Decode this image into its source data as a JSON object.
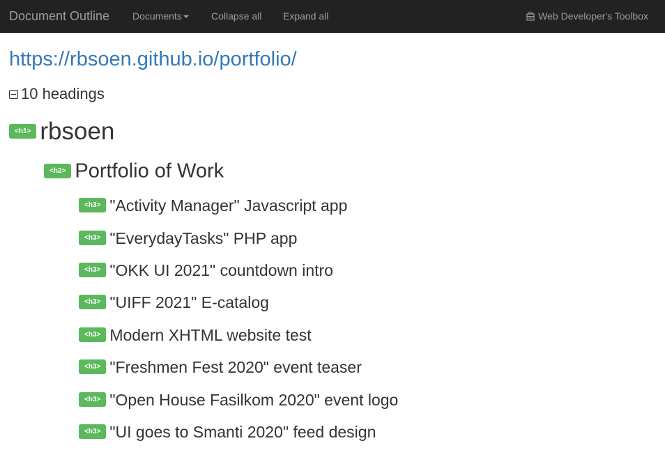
{
  "navbar": {
    "brand": "Document Outline",
    "documents_label": "Documents",
    "collapse_label": "Collapse all",
    "expand_label": "Expand all",
    "toolbox_label": "Web Developer's Toolbox"
  },
  "page": {
    "url": "https://rbsoen.github.io/portfolio/",
    "heading_count": "10 headings"
  },
  "headings": [
    {
      "tag": "<h1>",
      "text": "rbsoen"
    },
    {
      "tag": "<h2>",
      "text": "Portfolio of Work"
    },
    {
      "tag": "<h3>",
      "text": "\"Activity Manager\" Javascript app"
    },
    {
      "tag": "<h3>",
      "text": "\"EverydayTasks\" PHP app"
    },
    {
      "tag": "<h3>",
      "text": "\"OKK UI 2021\" countdown intro"
    },
    {
      "tag": "<h3>",
      "text": "\"UIFF 2021\" E-catalog"
    },
    {
      "tag": "<h3>",
      "text": "Modern XHTML website test"
    },
    {
      "tag": "<h3>",
      "text": "\"Freshmen Fest 2020\" event teaser"
    },
    {
      "tag": "<h3>",
      "text": "\"Open House Fasilkom 2020\" event logo"
    },
    {
      "tag": "<h3>",
      "text": "\"UI goes to Smanti 2020\" feed design"
    }
  ],
  "colors": {
    "navbar_bg": "#222222",
    "link": "#337ab7",
    "tag_bg": "#5cb85c"
  }
}
